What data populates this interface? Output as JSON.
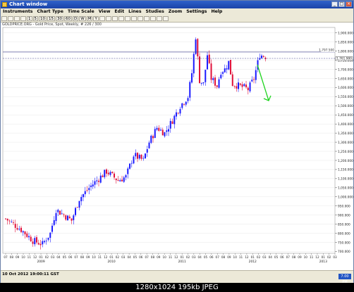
{
  "window": {
    "title": "Chart window",
    "buttons": [
      "_",
      "□",
      "×"
    ]
  },
  "menu": [
    "Instruments",
    "Chart Type",
    "Time Scale",
    "View",
    "Edit",
    "Lines",
    "Studies",
    "Zoom",
    "Settings",
    "Help"
  ],
  "toolbar": [
    "",
    "",
    "",
    "",
    "1",
    "5",
    "10",
    "15",
    "30",
    "60",
    "D",
    "W",
    "M",
    "Y",
    "",
    "",
    "",
    "",
    "",
    "",
    "",
    "",
    "",
    "",
    ""
  ],
  "info_line": "GOLDPRICE.ORG - Gold Price, Spot, Weekly, # 226 / 300",
  "status_text": "10 Oct 2012 19:00:11 GST",
  "status_box": "7.00 PM",
  "price_labels": {
    "resistance": "1,797.500",
    "current": "1,761.980"
  },
  "colors": {
    "up": "#1a1aff",
    "down": "#e0103a",
    "arrow": "#1fd41f",
    "hline": "#3a3a8a"
  },
  "image_caption": "1280x1024  195kb  JPEG",
  "chart_data": {
    "type": "candlestick",
    "y_ticks": [
      "1,900.000",
      "1,850.000",
      "1,800.000",
      "1,750.000",
      "1,700.000",
      "1,650.000",
      "1,600.000",
      "1,550.000",
      "1,500.000",
      "1,450.000",
      "1,400.000",
      "1,350.000",
      "1,300.000",
      "1,250.000",
      "1,200.000",
      "1,150.000",
      "1,100.000",
      "1,050.000",
      "1,000.000",
      "950.000",
      "900.000",
      "850.000",
      "800.000",
      "750.000",
      "700.000"
    ],
    "ylim": [
      690,
      1930
    ],
    "month_labels": [
      "07",
      "08",
      "09",
      "10",
      "11",
      "12",
      "01",
      "02",
      "03",
      "04",
      "05",
      "06",
      "07",
      "08",
      "09",
      "10",
      "11",
      "12",
      "01",
      "02",
      "03",
      "04",
      "05",
      "06",
      "07",
      "08",
      "09",
      "10",
      "11",
      "12",
      "01",
      "02",
      "03",
      "04",
      "05",
      "06",
      "07",
      "08",
      "09",
      "10",
      "11",
      "12",
      "01",
      "02",
      "03",
      "04",
      "05",
      "06",
      "07",
      "08",
      "09",
      "10",
      "11",
      "12",
      "01",
      "02",
      "03"
    ],
    "year_labels": [
      "2009",
      "2010",
      "2011",
      "2012",
      "2013",
      "2014"
    ],
    "close_path": [
      [
        0,
        880
      ],
      [
        8,
        820
      ],
      [
        14,
        760
      ],
      [
        19,
        740
      ],
      [
        23,
        800
      ],
      [
        26,
        930
      ],
      [
        34,
        870
      ],
      [
        38,
        990
      ],
      [
        44,
        1060
      ],
      [
        52,
        1140
      ],
      [
        58,
        1090
      ],
      [
        62,
        1110
      ],
      [
        66,
        1230
      ],
      [
        71,
        1200
      ],
      [
        74,
        1300
      ],
      [
        78,
        1380
      ],
      [
        82,
        1350
      ],
      [
        86,
        1420
      ],
      [
        90,
        1500
      ],
      [
        94,
        1550
      ],
      [
        96,
        1680
      ],
      [
        98,
        1880
      ],
      [
        100,
        1640
      ],
      [
        102,
        1620
      ],
      [
        104,
        1780
      ],
      [
        106,
        1650
      ],
      [
        109,
        1610
      ],
      [
        111,
        1690
      ],
      [
        113,
        1700
      ],
      [
        115,
        1740
      ],
      [
        117,
        1620
      ],
      [
        120,
        1610
      ],
      [
        123,
        1600
      ],
      [
        125,
        1590
      ],
      [
        128,
        1650
      ],
      [
        131,
        1780
      ],
      [
        134,
        1770
      ]
    ],
    "resistance": 1795,
    "current": 1760
  }
}
